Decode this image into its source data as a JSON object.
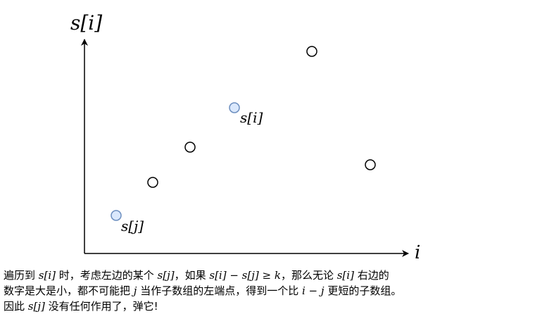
{
  "axes": {
    "y_label": "s[i]",
    "x_label": "i"
  },
  "points": [
    {
      "label": "s[j]",
      "highlighted": true
    },
    {
      "label": "",
      "highlighted": false
    },
    {
      "label": "",
      "highlighted": false
    },
    {
      "label": "s[i]",
      "highlighted": true
    },
    {
      "label": "",
      "highlighted": false
    },
    {
      "label": "",
      "highlighted": false
    }
  ],
  "colors": {
    "highlight_fill": "#dae8fc",
    "highlight_stroke": "#6c8ebf",
    "point_stroke": "#000000",
    "axis": "#000000"
  },
  "caption": {
    "line1": {
      "p1": "遍历到 ",
      "m1": "s[i]",
      "p2": " 时，考虑左边的某个 ",
      "m2": "s[j]",
      "p3": "，如果 ",
      "m3": "s[i] − s[j] ≥ k",
      "p4": "，那么无论 ",
      "m4": "s[i]",
      "p5": " 右边的"
    },
    "line2": {
      "p1": "数字是大是小，都不可能把 ",
      "m1": "j",
      "p2": " 当作子数组的左端点，得到一个比 ",
      "m2": "i − j",
      "p3": " 更短的子数组。"
    },
    "line3": {
      "p1": "因此 ",
      "m1": "s[j]",
      "p2": " 没有任何作用了，弹它!"
    }
  }
}
